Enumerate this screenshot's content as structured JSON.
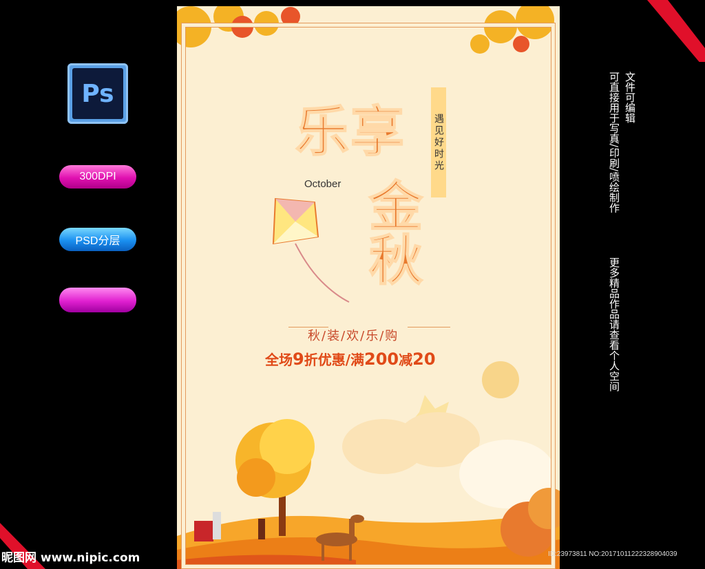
{
  "left_panel": {
    "ps_icon_text": "Ps",
    "badges": [
      "300DPI",
      "PSD分层",
      ""
    ]
  },
  "right_panel": {
    "columns": [
      "文件可编辑",
      "可直接用于写真/印刷/喷绘制作",
      "更多精品作品请查看个人空间"
    ]
  },
  "poster": {
    "title_line1": "乐享",
    "title_line2": "金秋",
    "tag_text": "遇见好时光",
    "month": "October",
    "slogan": "秋/装/欢/乐/购",
    "promo_prefix": "全场",
    "promo_num1": "9",
    "promo_mid": "折优惠/满",
    "promo_num2": "200",
    "promo_mid2": "减",
    "promo_num3": "20"
  },
  "watermark": {
    "left": "昵图网 www.nipic.com",
    "right": "ID:23973811 NO:20171011222328904039"
  },
  "colors": {
    "background": "#000000",
    "poster_bg": "#fcefd2",
    "accent_orange": "#e87a2e",
    "promo_red": "#e04a18",
    "pill_pink": "#e010b0",
    "pill_blue": "#1a8ff0"
  }
}
